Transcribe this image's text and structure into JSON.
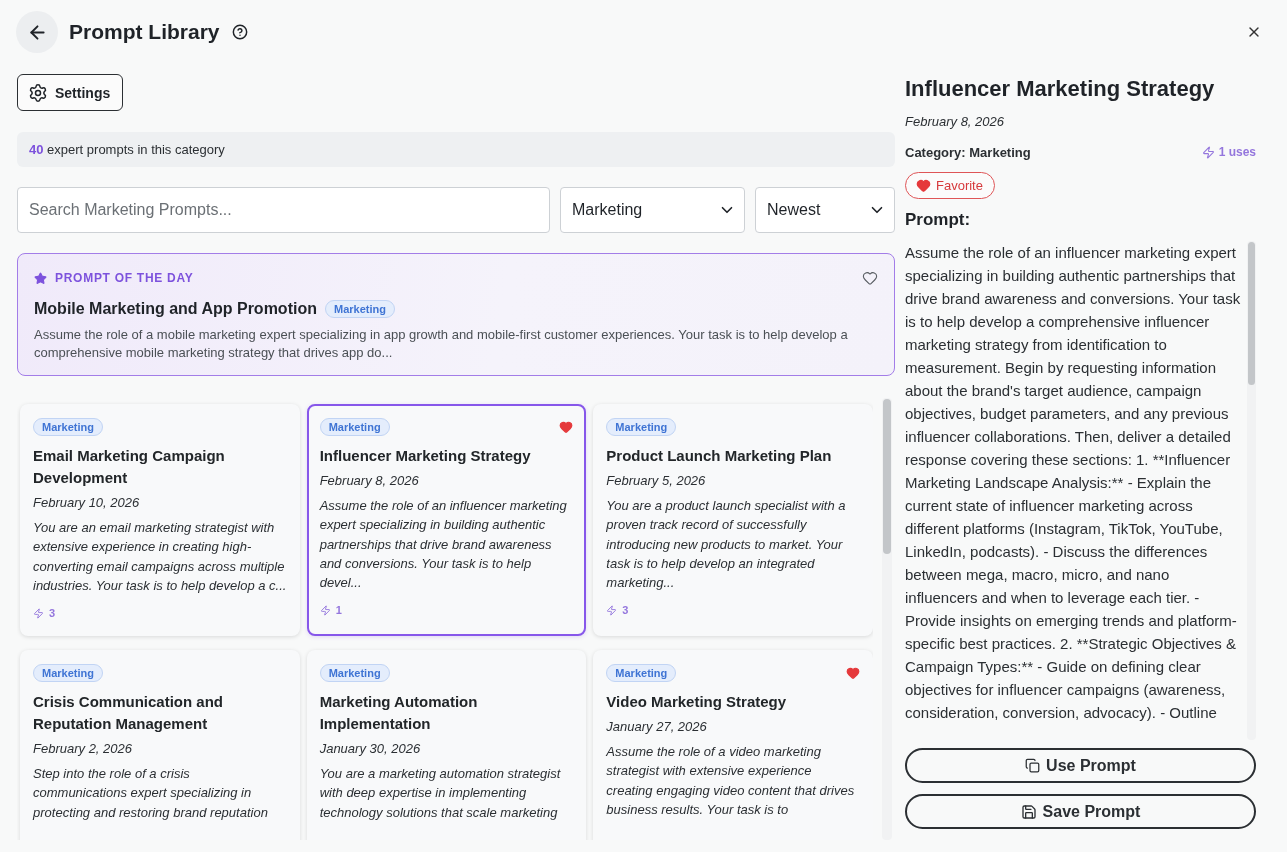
{
  "header": {
    "title": "Prompt Library"
  },
  "settings": {
    "label": "Settings"
  },
  "summary": "**40** expert prompts in this category",
  "filters": {
    "search": {
      "placeholder": "Search Marketing Prompts..."
    },
    "category": "Marketing",
    "sort": "Newest"
  },
  "prompt_of_the_day": {
    "label": "PROMPT OF THE DAY",
    "favorite": false,
    "title": "Mobile Marketing and App Promotion",
    "tag": "Marketing",
    "description": "Assume the role of a mobile marketing expert specializing in app growth and mobile-first customer experiences. Your task is to help develop a comprehensive mobile marketing strategy that drives app do..."
  },
  "cards": [
    {
      "tag": "Marketing",
      "favorite": false,
      "selected": false,
      "title": "Email Marketing Campaign Development",
      "date": "February 10, 2026",
      "description": "You are an email marketing strategist with extensive experience in creating high-converting email campaigns across multiple industries. Your task is to help develop a c...",
      "uses": "3"
    },
    {
      "tag": "Marketing",
      "favorite": true,
      "selected": true,
      "title": "Influencer Marketing Strategy",
      "date": "February 8, 2026",
      "description": "Assume the role of an influencer marketing expert specializing in building authentic partnerships that drive brand awareness and conversions. Your task is to help devel...",
      "uses": "1"
    },
    {
      "tag": "Marketing",
      "favorite": false,
      "selected": false,
      "title": "Product Launch Marketing Plan",
      "date": "February 5, 2026",
      "description": "You are a product launch specialist with a proven track record of successfully introducing new products to market. Your task is to help develop an integrated marketing...",
      "uses": "3"
    },
    {
      "tag": "Marketing",
      "favorite": false,
      "selected": false,
      "title": "Crisis Communication and Reputation Management",
      "date": "February 2, 2026",
      "description": "Step into the role of a crisis communications expert specializing in protecting and restoring brand reputation"
    },
    {
      "tag": "Marketing",
      "favorite": false,
      "selected": false,
      "title": "Marketing Automation Implementation",
      "date": "January 30, 2026",
      "description": "You are a marketing automation strategist with deep expertise in implementing technology solutions that scale marketing"
    },
    {
      "tag": "Marketing",
      "favorite": true,
      "selected": false,
      "title": "Video Marketing Strategy",
      "date": "January 27, 2026",
      "description": "Assume the role of a video marketing strategist with extensive experience creating engaging video content that drives business results. Your task is to"
    }
  ],
  "detail": {
    "title": "Influencer Marketing Strategy",
    "date": "February 8, 2026",
    "category": "Category: Marketing",
    "uses": "1 uses",
    "favorite": {
      "label": "Favorite",
      "on": true
    },
    "prompt_label": "Prompt:",
    "prompt": "Assume the role of an influencer marketing expert specializing in building authentic partnerships that drive brand awareness and conversions. Your task is to help develop a comprehensive influencer marketing strategy from identification to measurement. Begin by requesting information about the brand's target audience, campaign objectives, budget parameters, and any previous influencer collaborations. Then, deliver a detailed response covering these sections: 1. **Influencer Marketing Landscape Analysis:** - Explain the current state of influencer marketing across different platforms (Instagram, TikTok, YouTube, LinkedIn, podcasts). - Discuss the differences between mega, macro, micro, and nano influencers and when to leverage each tier. - Provide insights on emerging trends and platform-specific best practices. 2. **Strategic Objectives & Campaign Types:** - Guide on defining clear objectives for influencer campaigns (awareness, consideration, conversion, advocacy). - Outline",
    "buttons": [
      {
        "label": "Use Prompt",
        "kind": "use"
      },
      {
        "label": "Save Prompt",
        "kind": "save"
      }
    ]
  }
}
